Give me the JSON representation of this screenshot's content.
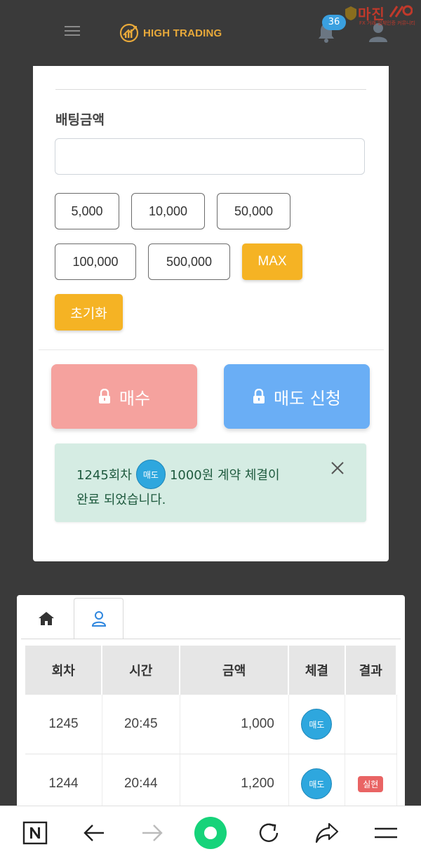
{
  "header": {
    "brand": "HIGH TRADING",
    "notification_count": "36",
    "watermark_title": "마진",
    "watermark_sub": "FX 거래 업체인증 커뮤니티"
  },
  "bet": {
    "label": "배팅금액",
    "input_value": "",
    "amounts": [
      "5,000",
      "10,000",
      "50,000",
      "100,000",
      "500,000"
    ],
    "max_label": "MAX",
    "reset_label": "초기화"
  },
  "actions": {
    "buy_label": "매수",
    "sell_label": "매도 신청"
  },
  "alert": {
    "round_text": "1245회차",
    "side_badge": "매도",
    "amount_text": "1000원 계약 체결이",
    "line2": "완료 되었습니다."
  },
  "table": {
    "headers": [
      "회차",
      "시간",
      "금액",
      "체결",
      "결과"
    ],
    "rows": [
      {
        "round": "1245",
        "time": "20:45",
        "amount": "1,000",
        "side": "매도",
        "result": ""
      },
      {
        "round": "1244",
        "time": "20:44",
        "amount": "1,200",
        "side": "매도",
        "result": "실현"
      }
    ]
  },
  "colors": {
    "gold": "#f5b324",
    "buy": "#f5a29e",
    "sell": "#6aaef5",
    "badge_blue": "#2ea7de",
    "alert_bg": "#d5ece3",
    "result_red": "#e96464"
  }
}
